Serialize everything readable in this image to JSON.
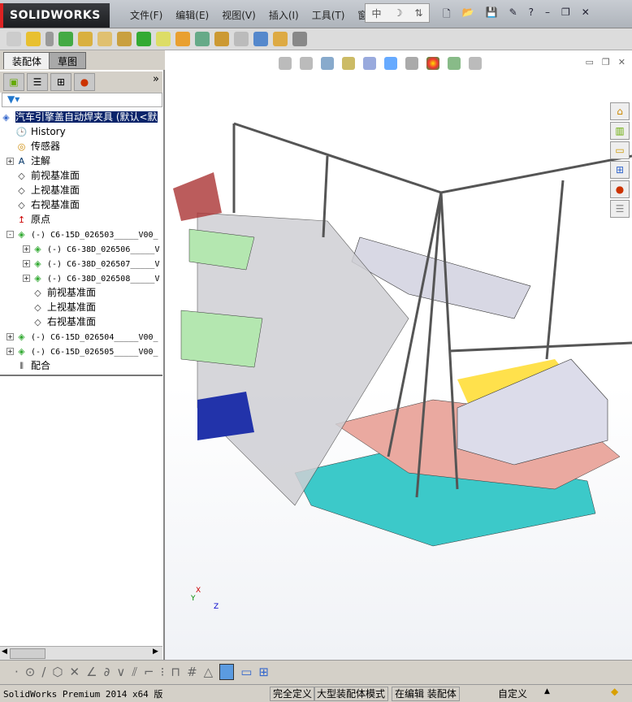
{
  "app": {
    "logo": "SOLIDWORKS",
    "menu": [
      "文件(F)",
      "编辑(E)",
      "视图(V)",
      "插入(I)",
      "工具(T)",
      "窗口(W)"
    ],
    "ime": [
      "中",
      "☽",
      "⇅"
    ]
  },
  "tabs": [
    "装配体",
    "草图"
  ],
  "tree": {
    "root": "汽车引擎盖自动焊夹具  (默认<默",
    "items": [
      {
        "label": "History",
        "icon": "history-icon",
        "level": 1,
        "exp": ""
      },
      {
        "label": "传感器",
        "icon": "sensor-icon",
        "level": 1,
        "exp": ""
      },
      {
        "label": "注解",
        "icon": "annotation-icon",
        "level": 1,
        "exp": "+"
      },
      {
        "label": "前视基准面",
        "icon": "plane-icon",
        "level": 1,
        "exp": ""
      },
      {
        "label": "上视基准面",
        "icon": "plane-icon",
        "level": 1,
        "exp": ""
      },
      {
        "label": "右视基准面",
        "icon": "plane-icon",
        "level": 1,
        "exp": ""
      },
      {
        "label": "原点",
        "icon": "origin-icon",
        "level": 1,
        "exp": ""
      },
      {
        "label": "(-) C6-15D_026503_____V00_",
        "icon": "subassembly-icon",
        "level": 1,
        "exp": "-"
      },
      {
        "label": "(-) C6-38D_026506_____V",
        "icon": "subassembly-icon",
        "level": 2,
        "exp": "+"
      },
      {
        "label": "(-) C6-38D_026507_____V",
        "icon": "subassembly-icon",
        "level": 2,
        "exp": "+"
      },
      {
        "label": "(-) C6-38D_026508_____V",
        "icon": "subassembly-icon",
        "level": 2,
        "exp": "+"
      },
      {
        "label": "前视基准面",
        "icon": "plane-icon",
        "level": 2,
        "exp": ""
      },
      {
        "label": "上视基准面",
        "icon": "plane-icon",
        "level": 2,
        "exp": ""
      },
      {
        "label": "右视基准面",
        "icon": "plane-icon",
        "level": 2,
        "exp": ""
      },
      {
        "label": "(-) C6-15D_026504_____V00_",
        "icon": "subassembly-icon",
        "level": 1,
        "exp": "+"
      },
      {
        "label": "(-) C6-15D_026505_____V00_",
        "icon": "subassembly-icon",
        "level": 1,
        "exp": "+"
      },
      {
        "label": "配合",
        "icon": "mates-icon",
        "level": 1,
        "exp": ""
      }
    ]
  },
  "axes": {
    "x": "X",
    "y": "Y",
    "z": "Z"
  },
  "status": {
    "product": "SolidWorks Premium 2014 x64 版",
    "defined": "完全定义",
    "mode": "大型装配体模式",
    "editing": "在编辑 装配体",
    "custom": "自定义"
  }
}
